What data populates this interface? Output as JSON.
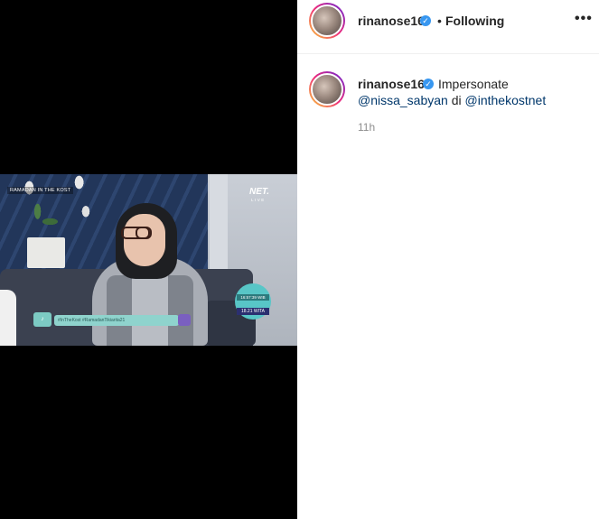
{
  "header": {
    "username": "rinanose16",
    "verified_icon": "verified-badge-icon",
    "separator": "•",
    "follow_status": "Following",
    "more_icon": "•••"
  },
  "video": {
    "program_logo": "RAMADAN IN THE KOST",
    "channel": "NET.",
    "live_label": "LIVE",
    "ticker_text": "#InTheKost #RamadanTikiarita21",
    "clock_line1": "16:57:39 WIB",
    "clock_line2": "18.21 WITA"
  },
  "caption": {
    "username": "rinanose16",
    "text": "Impersonate",
    "mention1": "@nissa_sabyan",
    "connector": " di ",
    "mention2": "@inthekostnet",
    "timestamp": "11h"
  },
  "colors": {
    "verified": "#3897f0",
    "mention": "#00376b",
    "muted": "#8e8e8e"
  }
}
